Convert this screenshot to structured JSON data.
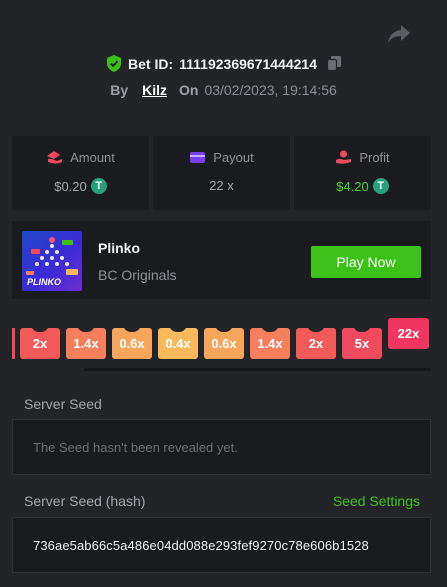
{
  "header": {
    "share_icon": "share-icon",
    "bet_id_label": "Bet ID:",
    "bet_id": "111192369671444214",
    "by_label": "By",
    "user": "Kilz",
    "on_label": "On",
    "date": "03/02/2023, 19:14:56"
  },
  "stats": [
    {
      "label": "Amount",
      "value": "$0.20",
      "icon": "amount-icon",
      "color": "#f0485f"
    },
    {
      "label": "Payout",
      "value": "22 x",
      "icon": "payout-card-icon",
      "color": "#7a3ff0"
    },
    {
      "label": "Profit",
      "value": "$4.20",
      "icon": "profit-icon",
      "color": "#f0485f"
    }
  ],
  "game": {
    "name": "Plinko",
    "provider": "BC Originals",
    "thumb_label": "PLINKO",
    "play_label": "Play Now"
  },
  "multipliers": [
    {
      "label": "2x",
      "color": "#f25a5a"
    },
    {
      "label": "1.4x",
      "color": "#f57f5c"
    },
    {
      "label": "0.6x",
      "color": "#f7a55b"
    },
    {
      "label": "0.4x",
      "color": "#f8b95b"
    },
    {
      "label": "0.6x",
      "color": "#f7a55b"
    },
    {
      "label": "1.4x",
      "color": "#f57f5c"
    },
    {
      "label": "2x",
      "color": "#f25a5a"
    },
    {
      "label": "5x",
      "color": "#f04a5e"
    },
    {
      "label": "22x",
      "color": "#f0365e",
      "hit": true
    }
  ],
  "server_seed": {
    "label": "Server Seed",
    "placeholder": "The Seed hasn't been revealed yet."
  },
  "server_seed_hash": {
    "label": "Server Seed (hash)",
    "settings_label": "Seed Settings",
    "value": "736ae5ab66c5a486e04dd088e293fef9270c78e606b1528"
  },
  "colors": {
    "background": "#232428",
    "panel": "#1a1b1e",
    "accent_green": "#3bc117",
    "shield_green": "#3bc117"
  }
}
